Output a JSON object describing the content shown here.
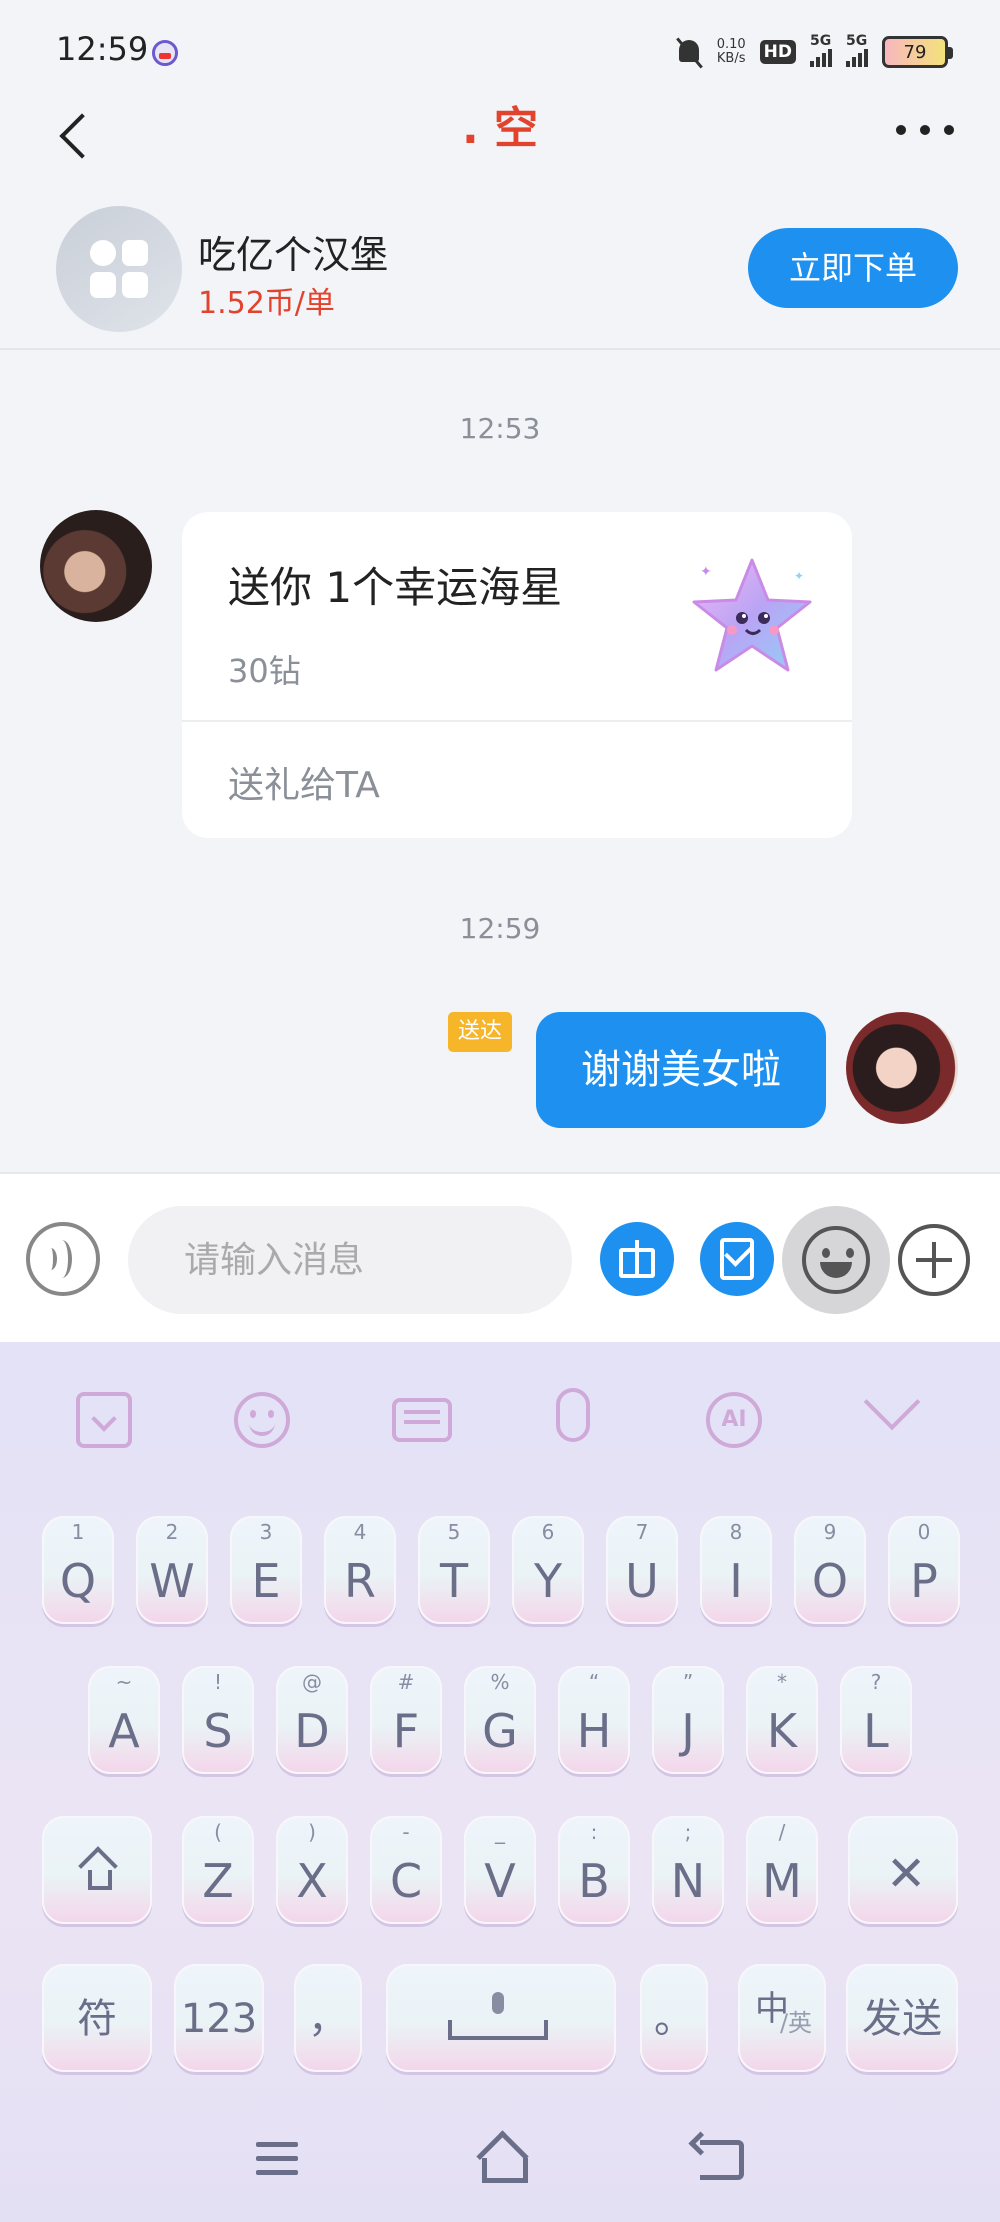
{
  "status_bar": {
    "time": "12:59",
    "net_speed_value": "0.10",
    "net_speed_unit": "KB/s",
    "hd_label": "HD",
    "sim1_label": "5G",
    "sim2_label": "5G",
    "battery": "79"
  },
  "header": {
    "title": ". 空"
  },
  "order": {
    "name": "吃亿个汉堡",
    "price": "1.52币/单",
    "button_label": "立即下单"
  },
  "chat": {
    "timestamp_1": "12:53",
    "gift_card": {
      "title": "送你 1个幸运海星",
      "price": "30钻",
      "action": "送礼给TA"
    },
    "timestamp_2": "12:59",
    "delivered_badge": "送达",
    "outgoing_message": "谢谢美女啦"
  },
  "input_bar": {
    "placeholder": "请输入消息"
  },
  "keyboard": {
    "toolbar_ai_label": "AI",
    "row1": [
      {
        "main": "Q",
        "sup": "1"
      },
      {
        "main": "W",
        "sup": "2"
      },
      {
        "main": "E",
        "sup": "3"
      },
      {
        "main": "R",
        "sup": "4"
      },
      {
        "main": "T",
        "sup": "5"
      },
      {
        "main": "Y",
        "sup": "6"
      },
      {
        "main": "U",
        "sup": "7"
      },
      {
        "main": "I",
        "sup": "8"
      },
      {
        "main": "O",
        "sup": "9"
      },
      {
        "main": "P",
        "sup": "0"
      }
    ],
    "row2": [
      {
        "main": "A",
        "sup": "~"
      },
      {
        "main": "S",
        "sup": "!"
      },
      {
        "main": "D",
        "sup": "@"
      },
      {
        "main": "F",
        "sup": "#"
      },
      {
        "main": "G",
        "sup": "%"
      },
      {
        "main": "H",
        "sup": "“"
      },
      {
        "main": "J",
        "sup": "”"
      },
      {
        "main": "K",
        "sup": "*"
      },
      {
        "main": "L",
        "sup": "?"
      }
    ],
    "row3": [
      {
        "main": "Z",
        "sup": "("
      },
      {
        "main": "X",
        "sup": ")"
      },
      {
        "main": "C",
        "sup": "-"
      },
      {
        "main": "V",
        "sup": "_"
      },
      {
        "main": "B",
        "sup": ":"
      },
      {
        "main": "N",
        "sup": ";"
      },
      {
        "main": "M",
        "sup": "/"
      }
    ],
    "delete_glyph": "✕",
    "symbol_key": "符",
    "number_key": "123",
    "comma_key": "，",
    "period_key": "。",
    "lang_key_main": "中",
    "lang_key_sub": "/英",
    "send_key": "发送"
  }
}
